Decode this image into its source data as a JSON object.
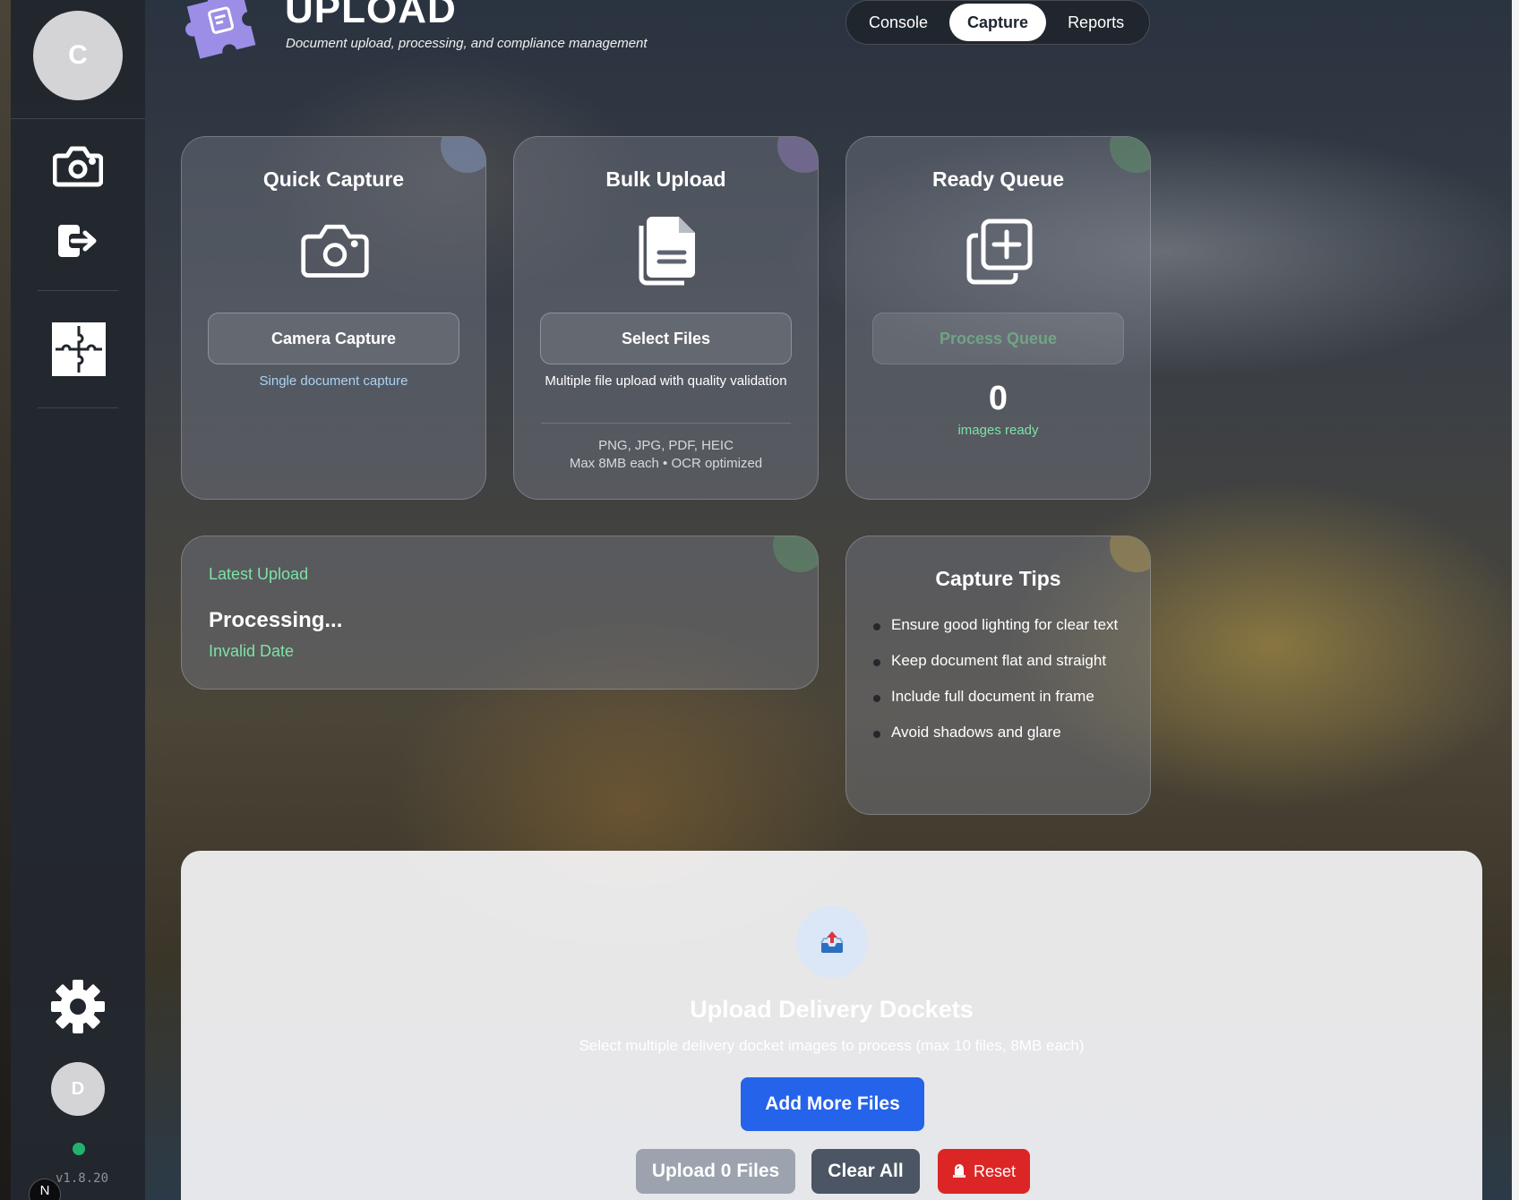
{
  "sidebar": {
    "avatar_initial": "C",
    "user_initial": "D",
    "version": "v1.8.20",
    "next_badge": "N",
    "icons": [
      "camera-icon",
      "logout-icon",
      "puzzle-icon",
      "gear-icon"
    ]
  },
  "header": {
    "title": "UPLOAD",
    "subtitle": "Document upload, processing, and compliance management",
    "tabs": [
      {
        "label": "Console",
        "active": false
      },
      {
        "label": "Capture",
        "active": true
      },
      {
        "label": "Reports",
        "active": false
      }
    ]
  },
  "cards": {
    "quick_capture": {
      "title": "Quick Capture",
      "button": "Camera Capture",
      "subtitle": "Single document capture",
      "subtitle_color": "#a9d3f5"
    },
    "bulk_upload": {
      "title": "Bulk Upload",
      "button": "Select Files",
      "subtitle": "Multiple file upload with quality validation",
      "formats": "PNG, JPG, PDF, HEIC",
      "limits": "Max 8MB each • OCR optimized"
    },
    "ready_queue": {
      "title": "Ready Queue",
      "button": "Process Queue",
      "count": "0",
      "count_label": "images ready",
      "accent": "#7ee2a8"
    },
    "latest_upload": {
      "label": "Latest Upload",
      "status": "Processing...",
      "date": "Invalid Date",
      "accent": "#7ee2a8"
    },
    "capture_tips": {
      "title": "Capture Tips",
      "items": [
        "Ensure good lighting for clear text",
        "Keep document flat and straight",
        "Include full document in frame",
        "Avoid shadows and glare"
      ]
    }
  },
  "upload_panel": {
    "icon": "inbox-tray-icon",
    "title": "Upload Delivery Dockets",
    "subtitle": "Select multiple delivery docket images to process (max 10 files, 8MB each)",
    "add_button": "Add More Files",
    "upload_button": "Upload 0 Files",
    "clear_button": "Clear All",
    "reset_button": "Reset",
    "colors": {
      "add": "#2563eb",
      "upload": "#9ca3af",
      "clear": "#4b5563",
      "reset": "#dc2626"
    }
  }
}
